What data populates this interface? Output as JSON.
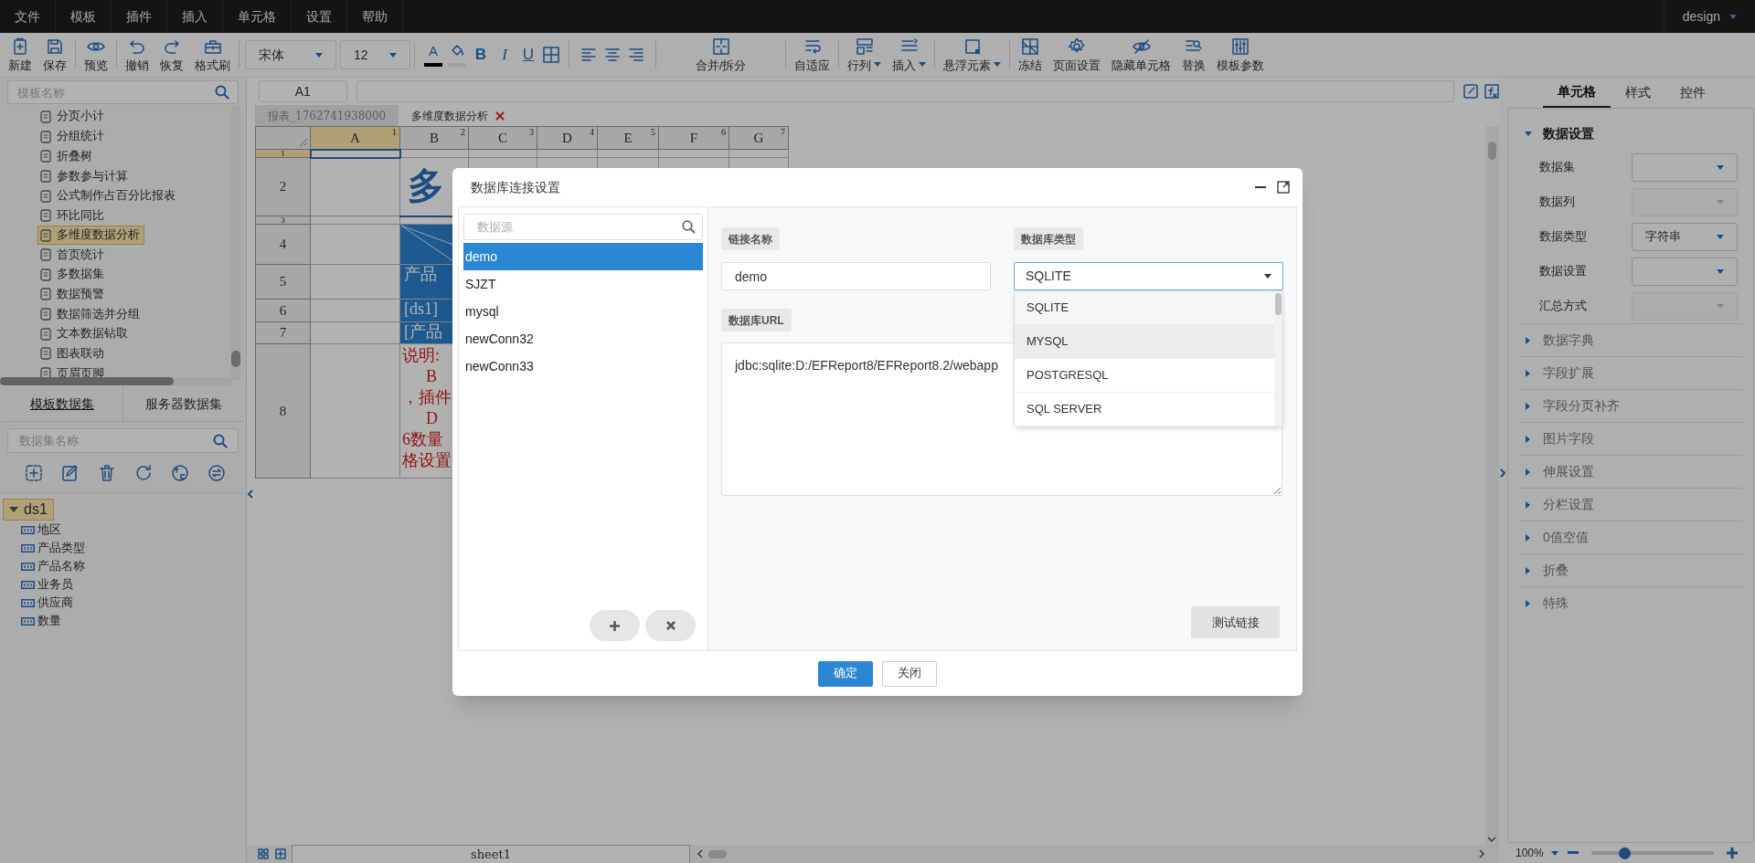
{
  "menu_bar": {
    "items": [
      "文件",
      "模板",
      "插件",
      "插入",
      "单元格",
      "设置",
      "帮助"
    ],
    "user": "design"
  },
  "toolbar": {
    "groups": [
      {
        "kind": "buttons",
        "items": [
          {
            "label": "新建"
          },
          {
            "label": "保存"
          }
        ]
      },
      {
        "kind": "buttons",
        "items": [
          {
            "label": "预览"
          }
        ]
      },
      {
        "kind": "buttons",
        "items": [
          {
            "label": "撤销"
          },
          {
            "label": "恢复"
          },
          {
            "label": "格式刷"
          }
        ]
      },
      {
        "kind": "font",
        "font": "宋体",
        "size": "12"
      },
      {
        "kind": "format",
        "tools": [
          {
            "kind": "font-color",
            "glyph": "A"
          },
          {
            "kind": "fill-color"
          },
          {
            "kind": "bold",
            "glyph": "B"
          },
          {
            "kind": "italic",
            "glyph": "I"
          },
          {
            "kind": "underline",
            "glyph": "U"
          },
          {
            "kind": "borders"
          }
        ]
      },
      {
        "kind": "align"
      },
      {
        "kind": "buttons",
        "wide": true,
        "items": [
          {
            "label": "合并/拆分"
          }
        ]
      },
      {
        "kind": "buttons",
        "items": [
          {
            "label": "自适应"
          }
        ]
      },
      {
        "kind": "buttons",
        "items": [
          {
            "label": "行列",
            "dropdown": true
          },
          {
            "label": "插入",
            "dropdown": true
          }
        ]
      },
      {
        "kind": "buttons",
        "items": [
          {
            "label": "悬浮元素",
            "dropdown": true
          }
        ]
      },
      {
        "kind": "buttons",
        "items": [
          {
            "label": "冻结"
          },
          {
            "label": "页面设置"
          },
          {
            "label": "隐藏单元格"
          },
          {
            "label": "替换"
          },
          {
            "label": "模板参数"
          }
        ]
      }
    ]
  },
  "template_search": {
    "placeholder": "模板名称"
  },
  "template_tree": [
    {
      "label": "分页小计",
      "selected": false
    },
    {
      "label": "分组统计",
      "selected": false
    },
    {
      "label": "折叠树",
      "selected": false
    },
    {
      "label": "参数参与计算",
      "selected": false
    },
    {
      "label": "公式制作占百分比报表",
      "selected": false
    },
    {
      "label": "环比同比",
      "selected": false
    },
    {
      "label": "多维度数据分析",
      "selected": true
    },
    {
      "label": "首页统计",
      "selected": false
    },
    {
      "label": "多数据集",
      "selected": false
    },
    {
      "label": "数据预警",
      "selected": false
    },
    {
      "label": "数据筛选并分组",
      "selected": false
    },
    {
      "label": "文本数据钻取",
      "selected": false
    },
    {
      "label": "图表联动",
      "selected": false
    },
    {
      "label": "页眉页脚",
      "selected": false
    }
  ],
  "dataset_tabs": [
    {
      "label": "模板数据集",
      "selected": true
    },
    {
      "label": "服务器数据集",
      "selected": false
    }
  ],
  "dataset_search": {
    "placeholder": "数据集名称"
  },
  "datasets": [
    {
      "name": "ds1",
      "expanded": true,
      "selected": true,
      "children": [
        {
          "name": "地区"
        },
        {
          "name": "产品类型"
        },
        {
          "name": "产品名称"
        },
        {
          "name": "业务员"
        },
        {
          "name": "供应商"
        },
        {
          "name": "数量"
        }
      ]
    }
  ],
  "cell_ref": "A1",
  "sheet_tabs": [
    {
      "label": "报表_1762741938000",
      "selected": false,
      "closable": false
    },
    {
      "label": "多维度数据分析",
      "selected": true,
      "closable": true
    }
  ],
  "grid": {
    "columns": [
      {
        "label": "A",
        "number": "1",
        "selected": true
      },
      {
        "label": "B",
        "number": "2",
        "selected": false
      },
      {
        "label": "C",
        "number": "3",
        "selected": false
      },
      {
        "label": "D",
        "number": "4",
        "selected": false
      },
      {
        "label": "E",
        "number": "5",
        "selected": false
      },
      {
        "label": "F",
        "number": "6",
        "selected": false
      },
      {
        "label": "G",
        "number": "7",
        "selected": false
      }
    ],
    "rows": [
      {
        "label": "1",
        "selected": true
      },
      {
        "label": "2",
        "selected": false,
        "b_cell": {
          "kind": "title",
          "lines": [
            "多"
          ]
        }
      },
      {
        "label": "3",
        "selected": false
      },
      {
        "label": "4",
        "selected": false,
        "b_cell": {
          "kind": "diagonal"
        }
      },
      {
        "label": "5",
        "selected": false,
        "b_cell": {
          "kind": "header",
          "lines": [
            "产品"
          ]
        }
      },
      {
        "label": "6",
        "selected": false,
        "b_cell": {
          "kind": "header",
          "lines": [
            "[ds1]"
          ]
        }
      },
      {
        "label": "7",
        "selected": false,
        "b_cell": {
          "kind": "header",
          "lines": [
            "[产品"
          ]
        }
      },
      {
        "label": "8",
        "selected": false,
        "b_cell": {
          "kind": "note",
          "lines": [
            "说明:",
            "B",
            "，插件",
            "D",
            "6数量",
            "格设置"
          ]
        }
      }
    ]
  },
  "sheets": [
    {
      "label": "sheet1",
      "selected": true
    }
  ],
  "property_tabs": [
    {
      "label": "单元格",
      "selected": true
    },
    {
      "label": "样式",
      "selected": false
    },
    {
      "label": "控件",
      "selected": false
    }
  ],
  "property_sections": [
    {
      "title": "数据设置",
      "expanded": true,
      "fields": [
        {
          "label": "数据集",
          "disabled": false
        },
        {
          "label": "数据列",
          "disabled": true
        },
        {
          "label": "数据类型",
          "disabled": false,
          "value": "字符串"
        },
        {
          "label": "数据设置",
          "disabled": false
        },
        {
          "label": "汇总方式",
          "disabled": true
        }
      ]
    },
    {
      "title": "数据字典",
      "expanded": false
    },
    {
      "title": "字段扩展",
      "expanded": false
    },
    {
      "title": "字段分页补齐",
      "expanded": false
    },
    {
      "title": "图片字段",
      "expanded": false
    },
    {
      "title": "伸展设置",
      "expanded": false
    },
    {
      "title": "分栏设置",
      "expanded": false
    },
    {
      "title": "0值空值",
      "expanded": false
    },
    {
      "title": "折叠",
      "expanded": false
    },
    {
      "title": "特殊",
      "expanded": false
    }
  ],
  "zoom": {
    "reading": "100%",
    "level": 0.27
  },
  "dialog": {
    "title": "数据库连接设置",
    "search": {
      "placeholder": "数据源"
    },
    "connections": [
      {
        "name": "demo",
        "selected": true
      },
      {
        "name": "SJZT",
        "selected": false
      },
      {
        "name": "mysql",
        "selected": false
      },
      {
        "name": "newConn32",
        "selected": false
      },
      {
        "name": "newConn33",
        "selected": false
      }
    ],
    "name_label": "链接名称",
    "name_value": "demo",
    "type_label": "数据库类型",
    "type_value": "SQLITE",
    "type_expanded": true,
    "type_options": [
      {
        "label": "SQLITE",
        "selected": true,
        "hovered": false
      },
      {
        "label": "MYSQL",
        "selected": false,
        "hovered": true
      },
      {
        "label": "POSTGRESQL",
        "selected": false,
        "hovered": false
      },
      {
        "label": "SQL SERVER",
        "selected": false,
        "hovered": false
      }
    ],
    "url_label": "数据库URL",
    "url_value": "jdbc:sqlite:D:/EFReport8/EFReport8.2/webapp",
    "test_button": "测试链接",
    "buttons": [
      {
        "label": "确定",
        "kind": "primary"
      },
      {
        "label": "关闭",
        "kind": "default"
      }
    ]
  }
}
